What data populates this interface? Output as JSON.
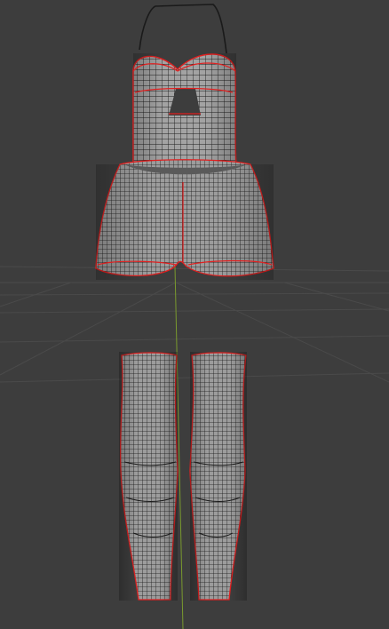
{
  "viewport": {
    "background": "#3d3d3d",
    "grid_color": "#4a4a4a",
    "z_axis_color": "#7a9a2e",
    "mesh_fill": "#9a9a9a",
    "wire_color": "#1e1e1e",
    "seam_color": "#e02020"
  },
  "objects": [
    {
      "name": "camisole-top"
    },
    {
      "name": "shorts"
    },
    {
      "name": "left-leg-warmer"
    },
    {
      "name": "right-leg-warmer"
    }
  ]
}
